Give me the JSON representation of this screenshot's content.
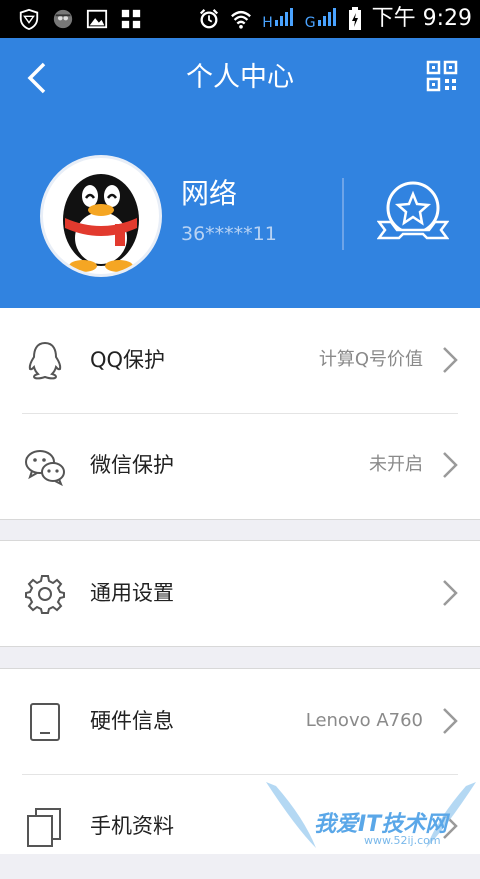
{
  "status_bar": {
    "time": "下午 9:29",
    "sim1": "H",
    "sim2": "G"
  },
  "header": {
    "title": "个人中心"
  },
  "profile": {
    "name": "网络",
    "qq_id": "36*****11"
  },
  "menu": {
    "qq_protect": {
      "label": "QQ保护",
      "value": "计算Q号价值"
    },
    "wechat_protect": {
      "label": "微信保护",
      "value": "未开启"
    },
    "general_settings": {
      "label": "通用设置"
    },
    "hardware_info": {
      "label": "硬件信息",
      "value": "Lenovo A760"
    },
    "phone_data": {
      "label": "手机资料"
    }
  },
  "watermark": {
    "text": "我爱IT技术网",
    "url": "www.52ij.com"
  },
  "colors": {
    "header_blue": "#3183e0",
    "background": "#efeff4"
  },
  "icons": [
    "shield-icon",
    "spy-icon",
    "image-icon",
    "grid-icon",
    "alarm-icon",
    "wifi-icon",
    "signal-icon",
    "battery-icon",
    "back-icon",
    "qr-code-icon",
    "star-badge-icon",
    "qq-penguin-icon",
    "wechat-icon",
    "gear-icon",
    "tablet-icon",
    "copy-icon",
    "chevron-right-icon"
  ]
}
